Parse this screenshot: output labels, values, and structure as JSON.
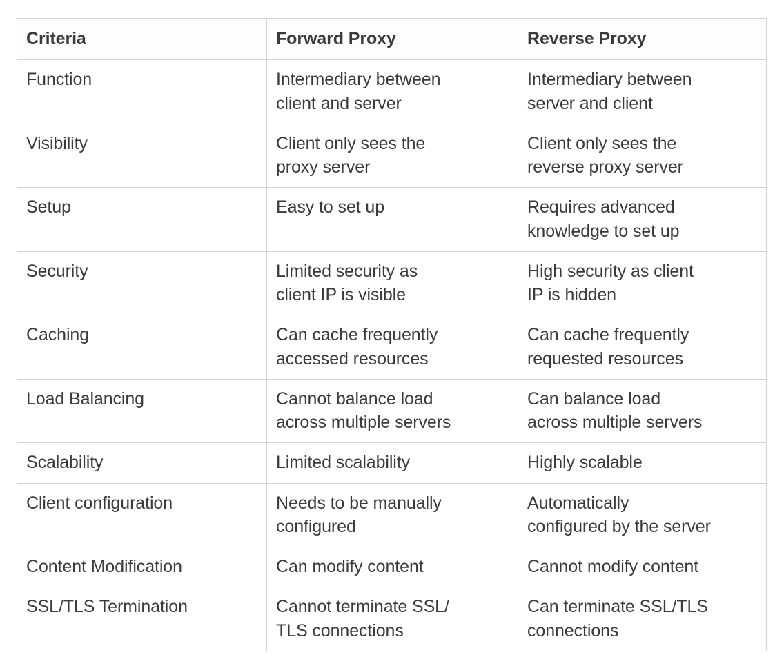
{
  "table": {
    "name": "forward-proxy-vs-reverse-proxy-comparison",
    "columns": [
      {
        "key": "criteria",
        "header": "Criteria"
      },
      {
        "key": "forward_proxy",
        "header": "Forward Proxy"
      },
      {
        "key": "reverse_proxy",
        "header": "Reverse Proxy"
      }
    ],
    "rows": [
      {
        "criteria": "Function",
        "forward_proxy": "Intermediary between client and server",
        "forward_proxy_lines": [
          "Intermediary between",
          "client and server"
        ],
        "reverse_proxy": "Intermediary between server and client",
        "reverse_proxy_lines": [
          "Intermediary between",
          "server and client"
        ],
        "height": "tall"
      },
      {
        "criteria": "Visibility",
        "forward_proxy": "Client only sees the proxy server",
        "forward_proxy_lines": [
          "Client only sees the",
          "proxy server"
        ],
        "reverse_proxy": "Client only sees the reverse proxy server",
        "reverse_proxy_lines": [
          "Client only sees the",
          "reverse proxy server"
        ],
        "height": "tall"
      },
      {
        "criteria": "Setup",
        "forward_proxy": "Easy to set up",
        "forward_proxy_lines": [
          "Easy to set up"
        ],
        "reverse_proxy": "Requires advanced knowledge to set up",
        "reverse_proxy_lines": [
          "Requires advanced",
          "knowledge to set up"
        ],
        "height": "tall"
      },
      {
        "criteria": "Security",
        "forward_proxy": "Limited security as client IP is visible",
        "forward_proxy_lines": [
          "Limited security as",
          "client IP is visible"
        ],
        "reverse_proxy": "High security as client IP is hidden",
        "reverse_proxy_lines": [
          "High security as client",
          "IP is hidden"
        ],
        "height": "tall"
      },
      {
        "criteria": "Caching",
        "forward_proxy": "Can cache frequently accessed resources",
        "forward_proxy_lines": [
          "Can cache frequently",
          "accessed resources"
        ],
        "reverse_proxy": "Can cache frequently requested resources",
        "reverse_proxy_lines": [
          "Can cache frequently",
          "requested resources"
        ],
        "height": "tall"
      },
      {
        "criteria": "Load Balancing",
        "forward_proxy": "Cannot balance load across multiple servers",
        "forward_proxy_lines": [
          "Cannot balance load",
          "across multiple servers"
        ],
        "reverse_proxy": "Can balance load across multiple servers",
        "reverse_proxy_lines": [
          "Can balance load",
          "across multiple servers"
        ],
        "height": "tall"
      },
      {
        "criteria": "Scalability",
        "forward_proxy": "Limited scalability",
        "forward_proxy_lines": [
          "Limited scalability"
        ],
        "reverse_proxy": "Highly scalable",
        "reverse_proxy_lines": [
          "Highly scalable"
        ],
        "height": "short"
      },
      {
        "criteria": "Client configuration",
        "forward_proxy": "Needs to be manually configured",
        "forward_proxy_lines": [
          "Needs to be manually",
          "configured"
        ],
        "reverse_proxy": "Automatically configured by the server",
        "reverse_proxy_lines": [
          "Automatically",
          "configured by the server"
        ],
        "height": "tall"
      },
      {
        "criteria": "Content Modification",
        "forward_proxy": "Can modify content",
        "forward_proxy_lines": [
          "Can modify content"
        ],
        "reverse_proxy": "Cannot modify content",
        "reverse_proxy_lines": [
          "Cannot modify content"
        ],
        "height": "short"
      },
      {
        "criteria": "SSL/TLS Termination",
        "forward_proxy": "Cannot terminate SSL/TLS connections",
        "forward_proxy_lines": [
          "Cannot terminate SSL/",
          "TLS connections"
        ],
        "reverse_proxy": "Can terminate SSL/TLS connections",
        "reverse_proxy_lines": [
          "Can terminate SSL/TLS",
          "connections"
        ],
        "height": "tall"
      }
    ]
  },
  "colors": {
    "text": "#3b3b3d",
    "border": "#d4d4d6",
    "background": "#ffffff",
    "header_background": "#fdfdfd"
  }
}
